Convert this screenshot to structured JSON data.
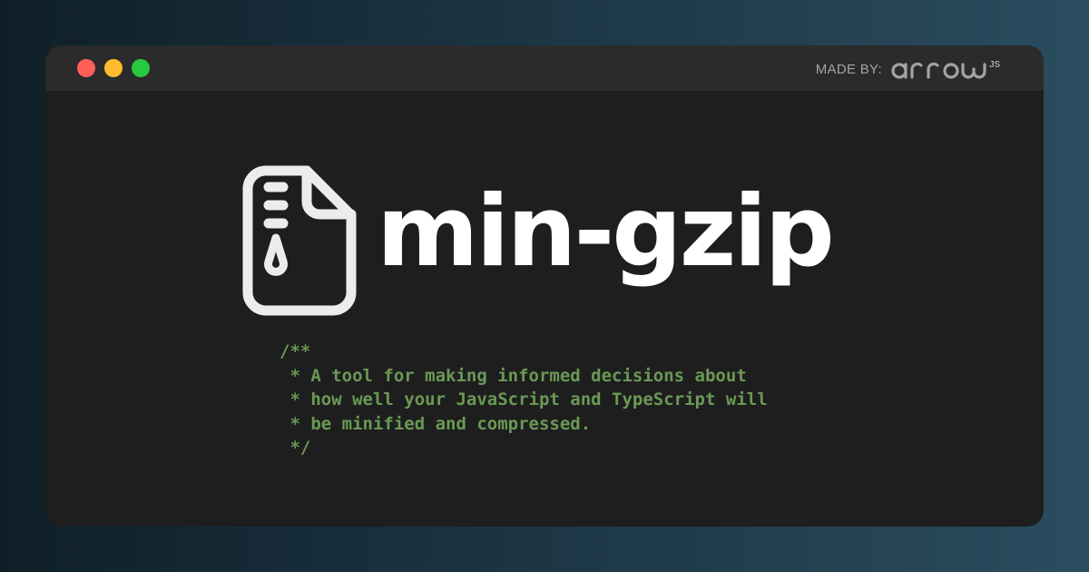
{
  "window": {
    "controls": {
      "close_color": "#ff5f57",
      "minimize_color": "#febc2e",
      "maximize_color": "#28c840"
    },
    "made_by_label": "MADE BY:",
    "brand": {
      "name": "arrow",
      "suffix": "JS"
    }
  },
  "hero": {
    "icon": "zip-file-icon",
    "title": "min-gzip"
  },
  "comment": {
    "lines": [
      "/**",
      " * A tool for making informed decisions about",
      " * how well your JavaScript and TypeScript will",
      " * be minified and compressed.",
      " */"
    ],
    "color": "#6a9955"
  }
}
